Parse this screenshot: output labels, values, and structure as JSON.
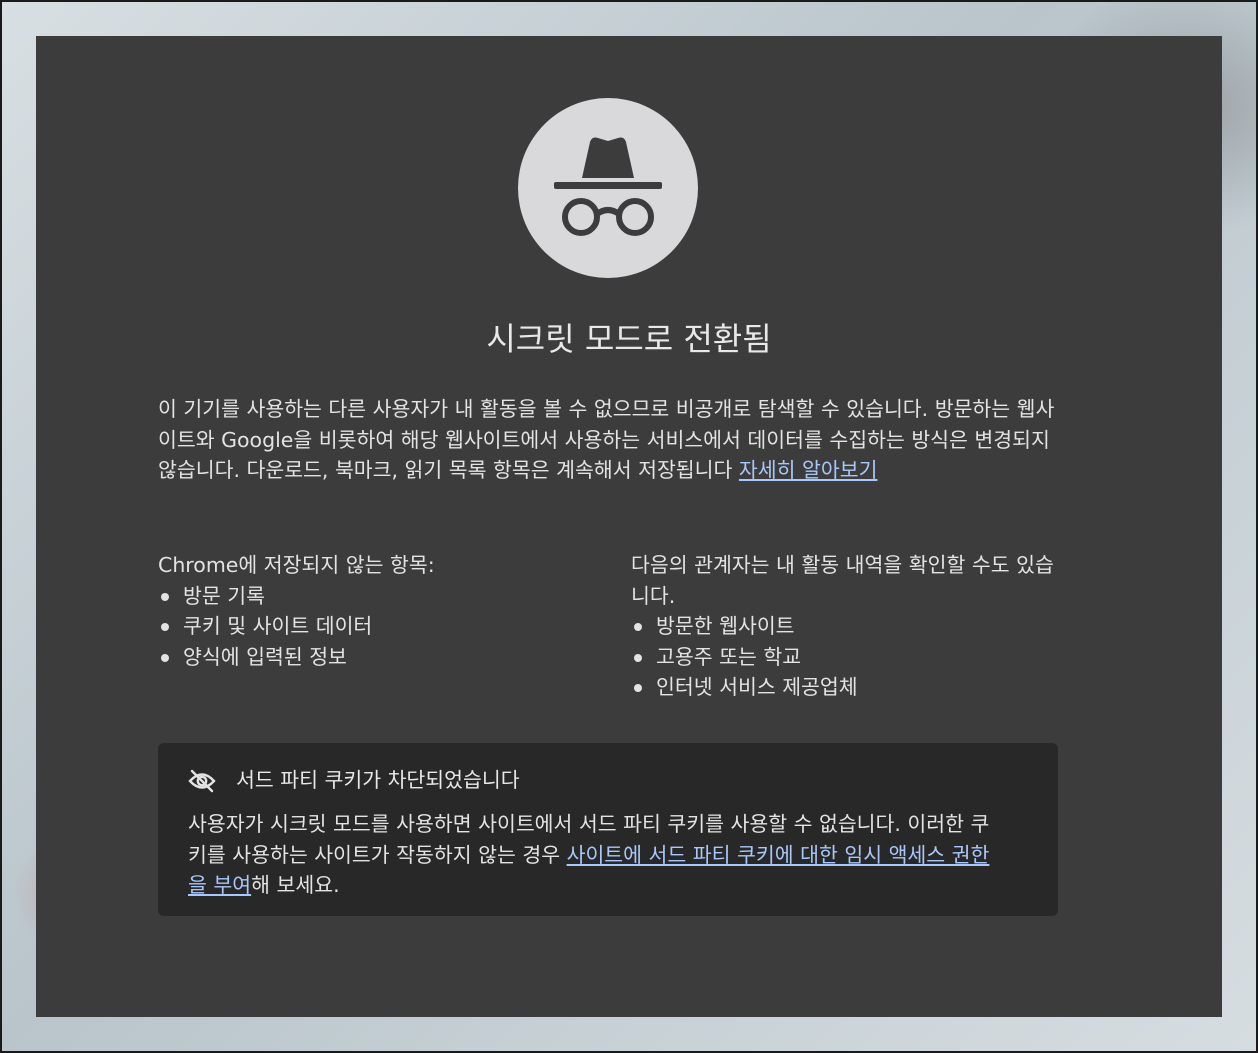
{
  "page": {
    "title": "시크릿 모드로 전환됨",
    "intro_text": "이 기기를 사용하는 다른 사용자가 내 활동을 볼 수 없으므로 비공개로 탐색할 수 있습니다. 방문하는 웹사이트와 Google을 비롯하여 해당 웹사이트에서 사용하는 서비스에서 데이터를 수집하는 방식은 변경되지 않습니다. 다운로드, 북마크, 읽기 목록 항목은 계속해서 저장됩니다 ",
    "intro_link": "자세히 알아보기"
  },
  "not_saved": {
    "heading": "Chrome에 저장되지 않는 항목:",
    "items": [
      "방문 기록",
      "쿠키 및 사이트 데이터",
      "양식에 입력된 정보"
    ]
  },
  "visible_to": {
    "heading": "다음의 관계자는 내 활동 내역을 확인할 수도 있습니다.",
    "items": [
      "방문한 웹사이트",
      "고용주 또는 학교",
      "인터넷 서비스 제공업체"
    ]
  },
  "cookies": {
    "title": "서드 파티 쿠키가 차단되었습니다",
    "body_text": "사용자가 시크릿 모드를 사용하면 사이트에서 서드 파티 쿠키를 사용할 수 없습니다. 이러한 쿠키를 사용하는 사이트가 작동하지 않는 경우 ",
    "body_link": "사이트에 서드 파티 쿠키에 대한 임시 액세스 권한을 부여",
    "body_suffix": "해 보세요."
  },
  "icons": {
    "hero": "incognito-icon",
    "cookie": "eye-off-icon"
  },
  "colors": {
    "panel_background": "#3c3c3c",
    "cookie_box_background": "#282828",
    "icon_circle": "#d9d9dc",
    "icon_glyph": "#3c3c3c",
    "link": "#a8c7fa",
    "text": "#e3e3e3"
  }
}
